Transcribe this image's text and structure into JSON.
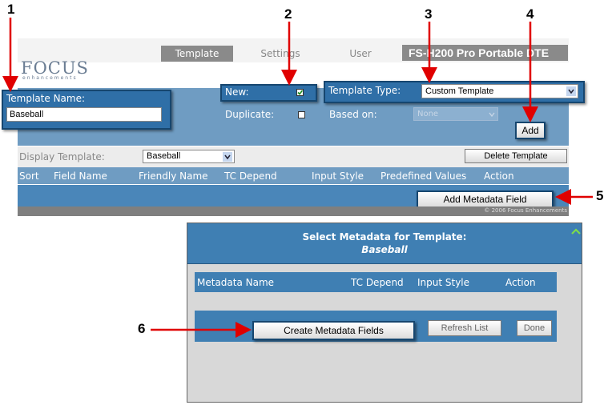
{
  "callouts": [
    "1",
    "2",
    "3",
    "4",
    "5",
    "6"
  ],
  "tabs": {
    "template": "Template",
    "settings": "Settings",
    "user": "User"
  },
  "product_title": "FS-H200 Pro Portable DTE",
  "logo": {
    "main": "FOCUS",
    "sub": "enhancements"
  },
  "template_name": {
    "label": "Template Name:",
    "value": "Baseball"
  },
  "new_section": {
    "new_label": "New:",
    "new_checked": true,
    "duplicate_label": "Duplicate:",
    "duplicate_checked": false
  },
  "template_type": {
    "label": "Template Type:",
    "value": "Custom Template"
  },
  "based_on": {
    "label": "Based on:",
    "value": "None"
  },
  "add_button": "Add",
  "display_template": {
    "label": "Display Template:",
    "value": "Baseball"
  },
  "delete_template_button": "Delete Template",
  "columns": [
    "Sort",
    "Field Name",
    "Friendly Name",
    "TC Depend",
    "Input Style",
    "Predefined Values",
    "Action"
  ],
  "add_metadata_button": "Add Metadata Field",
  "copyright": "© 2006 Focus Enhancements",
  "dialog": {
    "title": "Select Metadata for Template:",
    "subtitle": "Baseball",
    "columns": [
      "Metadata Name",
      "TC Depend",
      "Input Style",
      "Action"
    ],
    "create_button": "Create Metadata Fields",
    "refresh_button": "Refresh List",
    "done_button": "Done"
  },
  "colors": {
    "callout_arrow": "#e00000",
    "panel_blue": "#6f9cc2",
    "dialog_blue": "#3f7fb3"
  }
}
